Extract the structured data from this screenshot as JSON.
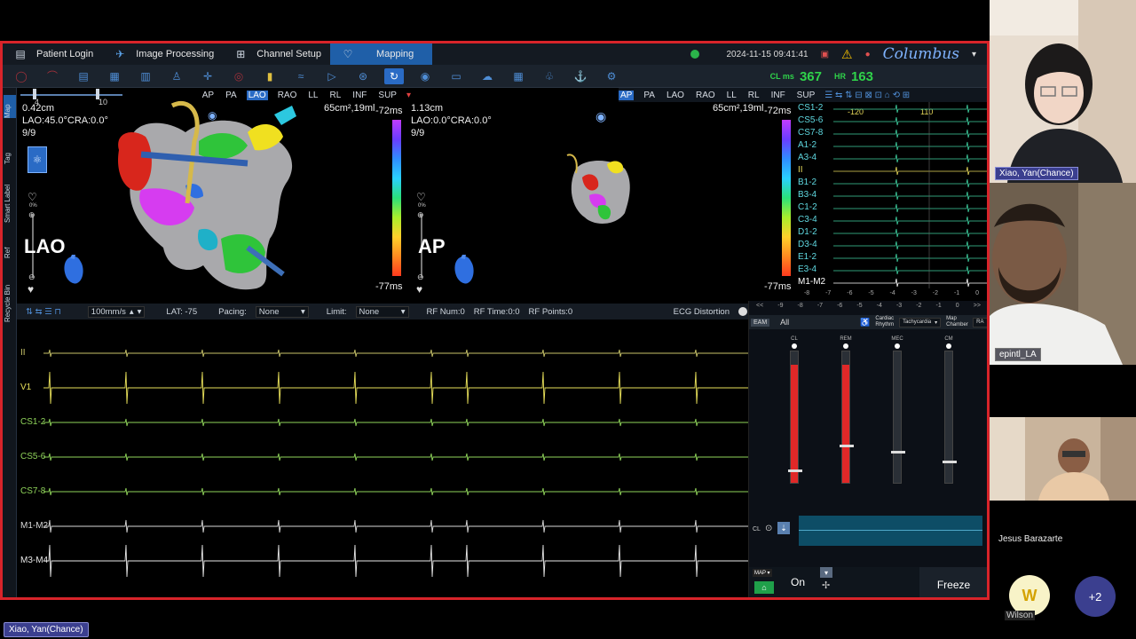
{
  "menu": {
    "tabs": [
      {
        "label": "Patient Login",
        "icon": "id-card-icon"
      },
      {
        "label": "Image Processing",
        "icon": "image-processing-icon"
      },
      {
        "label": "Channel Setup",
        "icon": "channel-setup-icon"
      },
      {
        "label": "Mapping",
        "icon": "mapping-icon",
        "active": true
      }
    ],
    "datetime": "2024-11-15 09:41:41",
    "brand": "Columbus"
  },
  "vitals": {
    "cl_label": "CL ms",
    "cl_value": "367",
    "hr_label": "HR",
    "hr_value": "163"
  },
  "left_strip": [
    "Map",
    "Tag",
    "Smart Label",
    "Ref",
    "Recycle Bin"
  ],
  "view_buttons": [
    "AP",
    "PA",
    "LAO",
    "RAO",
    "LL",
    "RL",
    "INF",
    "SUP"
  ],
  "view_left": {
    "selected": "LAO",
    "scale_ticks": [
      "4",
      "10"
    ],
    "distance": "0.42cm",
    "angle": "LAO:45.0°CRA:0.0°",
    "count": "9/9",
    "area": "65cm²,19ml",
    "max_ms": "-72ms",
    "min_ms": "-77ms",
    "orientation": "LAO",
    "zoom_pct": "0%"
  },
  "view_right": {
    "selected": "AP",
    "distance": "1.13cm",
    "angle": "LAO:0.0°CRA:0.0°",
    "count": "9/9",
    "area": "65cm²,19ml",
    "max_ms": "-72ms",
    "min_ms": "-77ms",
    "orientation": "AP",
    "zoom_pct": "0%"
  },
  "egm": {
    "channels": [
      "CS1-2",
      "CS5-6",
      "CS7-8",
      "A1-2",
      "A3-4",
      "II",
      "B1-2",
      "B3-4",
      "C1-2",
      "C3-4",
      "D1-2",
      "D3-4",
      "E1-2",
      "E3-4",
      "M1-M2"
    ],
    "marker_left": "-120",
    "marker_right": "110",
    "axis_ticks": [
      "-8",
      "-7",
      "-6",
      "-5",
      "-4",
      "-3",
      "-2",
      "-1",
      "0"
    ]
  },
  "ecg_header": {
    "speed": "100mm/s",
    "lat": "LAT: -75",
    "pacing_label": "Pacing:",
    "pacing_value": "None",
    "limit_label": "Limit:",
    "limit_value": "None",
    "rf_num": "RF Num:0",
    "rf_time": "RF Time:0:0",
    "rf_points": "RF Points:0",
    "distortion": "ECG Distortion"
  },
  "ecg_channels": [
    "II",
    "V1",
    "CS1-2",
    "CS5-6",
    "CS7-8",
    "M1-M2",
    "M3-M4"
  ],
  "ecg_colors": [
    "#c9c46a",
    "#e8e05a",
    "#8fd35a",
    "#8fd35a",
    "#8fd35a",
    "#d8d8d8",
    "#e8e8e8"
  ],
  "controls": {
    "all_label": "All",
    "tag": "EAM",
    "rhythm_label": "Cardiac Rhythm",
    "rhythm_value": "Tachycardia",
    "chamber_label": "Map Chamber",
    "chamber_value": "RA",
    "sliders": [
      {
        "label": "CL",
        "level": 0.9,
        "knob": 0.08,
        "active": true
      },
      {
        "label": "REM",
        "level": 0.9,
        "knob": 0.27,
        "active": true
      },
      {
        "label": "MEC",
        "level": 0,
        "knob": 0.22,
        "active": false
      },
      {
        "label": "CM",
        "level": 0,
        "knob": 0.15,
        "active": false
      }
    ],
    "cl_row_label": "CL",
    "on_label": "On",
    "freeze_label": "Freeze"
  },
  "participants": [
    {
      "name": "Xiao, Yan(Chance)"
    },
    {
      "name": "epintl_LA"
    },
    {
      "name": "Jesus Barazarte"
    }
  ],
  "wilson": {
    "initial": "W",
    "name": "Wilson"
  },
  "more_count": "+2",
  "speaker_label": "Xiao, Yan(Chance)"
}
